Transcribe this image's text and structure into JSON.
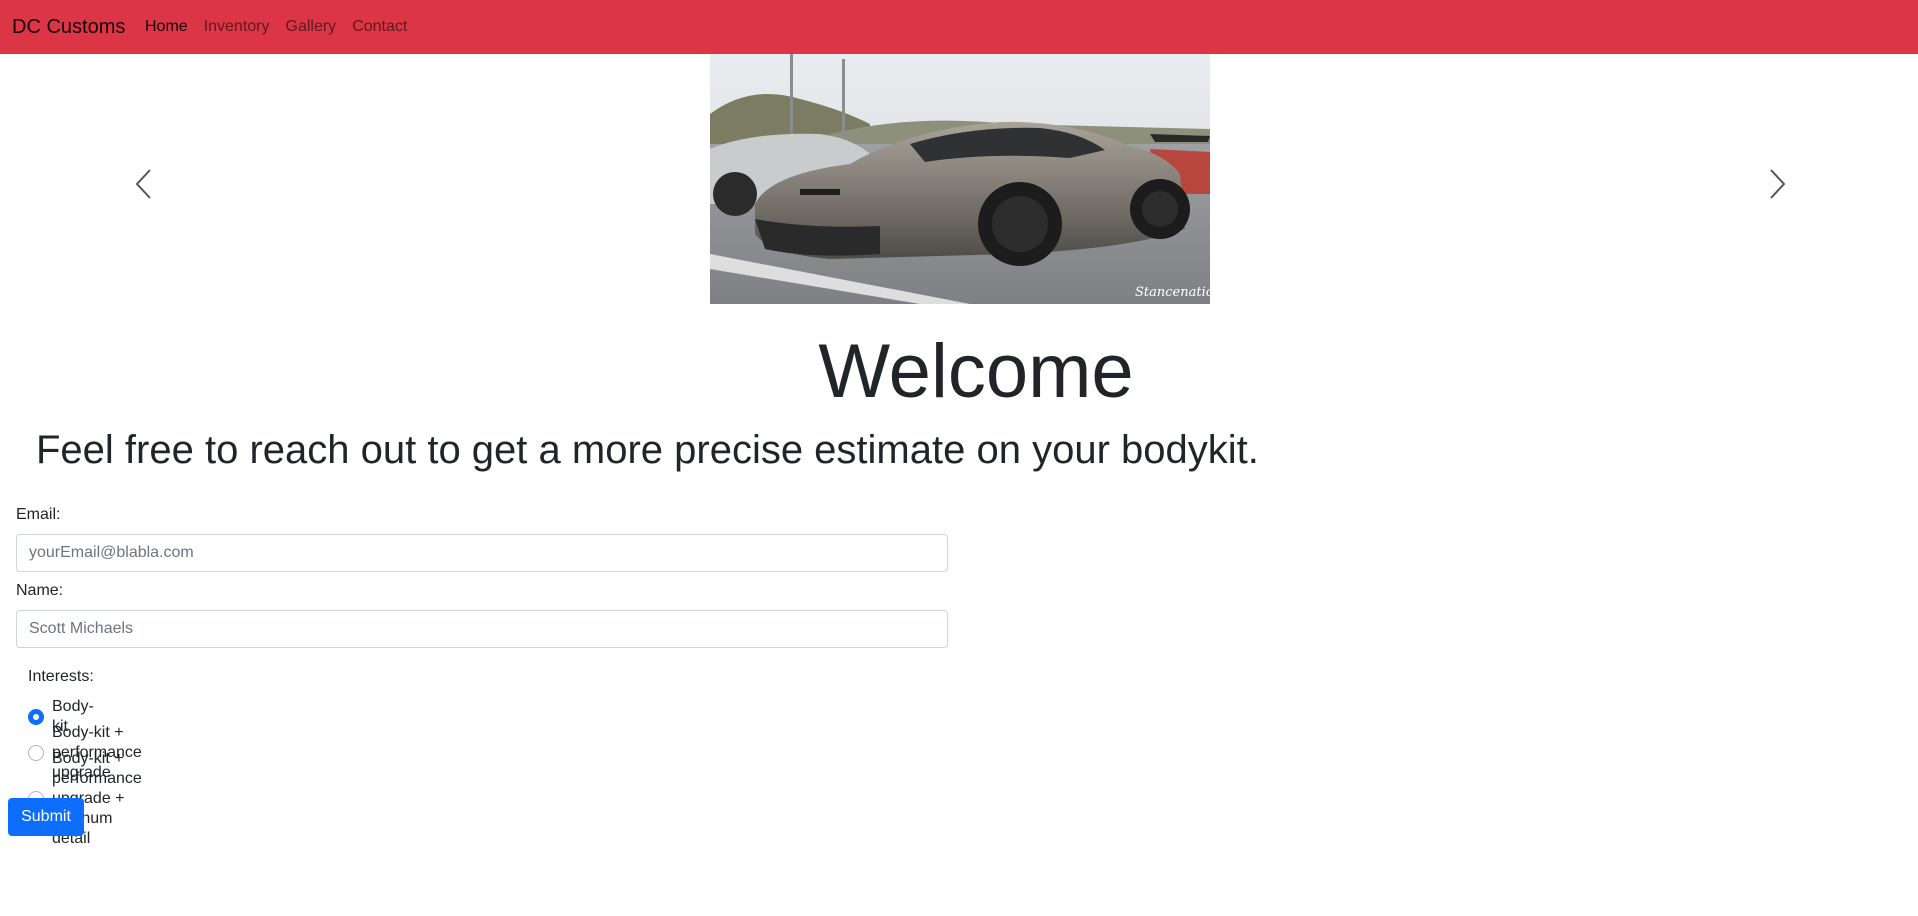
{
  "navbar": {
    "brand": "DC Customs",
    "links": [
      {
        "label": "Home",
        "active": true
      },
      {
        "label": "Inventory",
        "active": false
      },
      {
        "label": "Gallery",
        "active": false
      },
      {
        "label": "Contact",
        "active": false
      }
    ],
    "background_color": "#dc3545"
  },
  "carousel": {
    "image_alt": "Grey widebody sports car parked in a lot",
    "watermark": "Stancenation"
  },
  "hero": {
    "title": "Welcome",
    "subtitle": "Feel free to reach out to get a more precise estimate on your bodykit."
  },
  "form": {
    "email_label": "Email:",
    "email_placeholder": "yourEmail@blabla.com",
    "name_label": "Name:",
    "name_placeholder": "Scott Michaels",
    "interests_label": "Interests:",
    "interests": [
      {
        "label": "Body-kit",
        "checked": true
      },
      {
        "label": "Body-kit + performance upgrade",
        "checked": false
      },
      {
        "label": "Body-kit + performance upgrade + platinum detail",
        "checked": false
      }
    ],
    "submit_label": "Submit",
    "accent_color": "#0d6efd"
  }
}
